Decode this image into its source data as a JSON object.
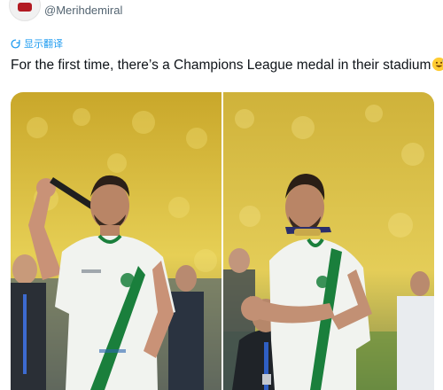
{
  "post": {
    "handle": "@Merihdemiral",
    "translate_label": "显示翻译",
    "text": "For the first time, there’s a Champions League medal in their stadium"
  },
  "media": {
    "photos": [
      {
        "alt_icon": "photo-left"
      },
      {
        "alt_icon": "photo-right"
      }
    ]
  },
  "colors": {
    "link": "#1d9bf0",
    "text": "#0f1419",
    "muted": "#536471",
    "jersey_green": "#1a7f3c",
    "crowd_yellow": "#e1c43a"
  }
}
